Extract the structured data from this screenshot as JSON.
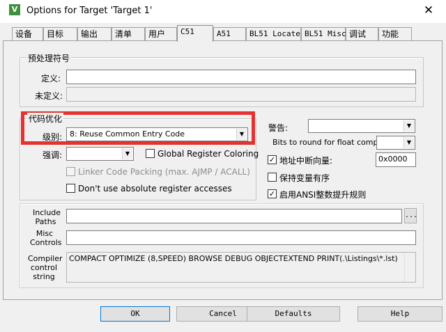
{
  "window": {
    "title": "Options for Target 'Target 1'",
    "close": "✕"
  },
  "tabs": [
    "设备",
    "目标",
    "输出",
    "清单",
    "用户",
    "C51",
    "A51",
    "BL51 Locate",
    "BL51 Misc",
    "调试",
    "功能"
  ],
  "preprocessor": {
    "legend": "预处理符号",
    "define_label": "定义:",
    "define_value": "",
    "undefine_label": "未定义:",
    "undefine_value": ""
  },
  "optimization": {
    "legend": "代码优化",
    "level_label": "级别:",
    "level_value": "8: Reuse Common Entry Code",
    "emphasis_label": "强调:",
    "emphasis_value": "",
    "global_register_coloring": "Global Register Coloring",
    "linker_code_packing": "Linker Code Packing (max. AJMP / ACALL)",
    "dont_use_absolute": "Don't use absolute register accesses"
  },
  "right": {
    "warnings_label": "警告:",
    "warnings_value": "",
    "bits_round_label": "Bits to round for float compare:",
    "bits_round_value": "",
    "interrupt_vector_label": "地址中断向量:",
    "interrupt_vector_value": "0x0000",
    "keep_variables_label": "保持变量有序",
    "ansi_int_label": "启用ANSI整数提升规则"
  },
  "include_paths": {
    "label_line1": "Include",
    "label_line2": "Paths",
    "value": "",
    "browse": "..."
  },
  "misc_controls": {
    "label_line1": "Misc",
    "label_line2": "Controls",
    "value": ""
  },
  "compiler_control": {
    "label_line1": "Compiler",
    "label_line2": "control",
    "label_line3": "string",
    "value": "COMPACT OPTIMIZE (8,SPEED) BROWSE DEBUG OBJECTEXTEND PRINT(.\\Listings\\*.lst)"
  },
  "buttons": {
    "ok": "OK",
    "cancel": "Cancel",
    "defaults": "Defaults",
    "help": "Help"
  }
}
